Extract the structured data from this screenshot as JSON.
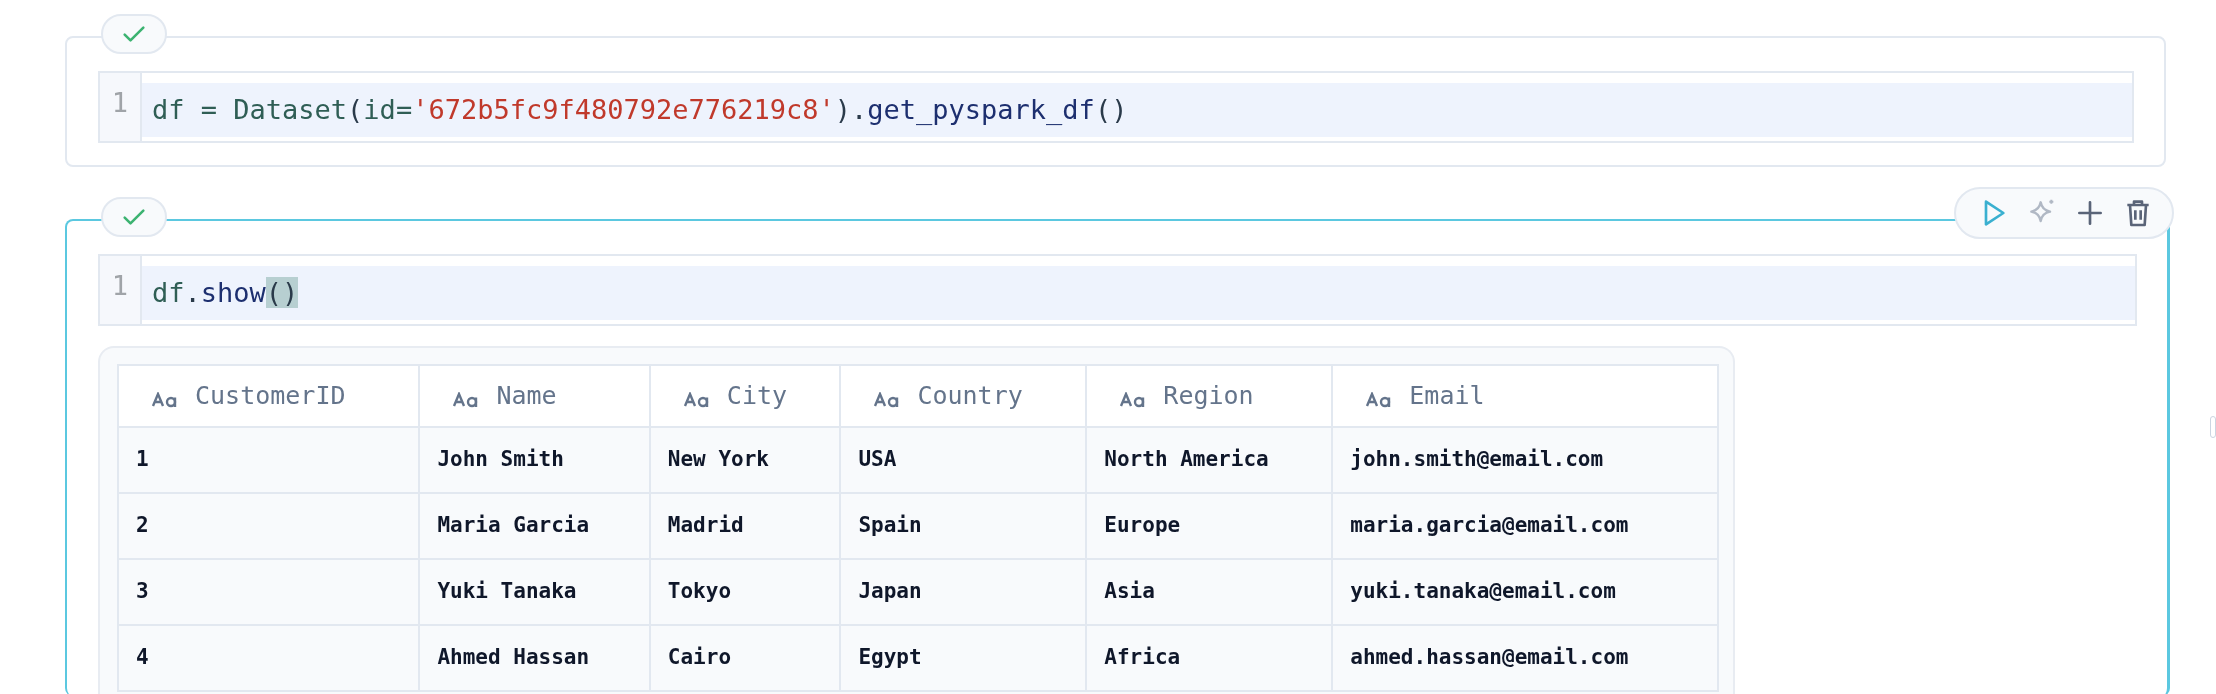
{
  "cells": [
    {
      "succeeded": true,
      "selected": false,
      "lines": [
        {
          "number": "1",
          "tokens": [
            {
              "kind": "name",
              "text": "df"
            },
            {
              "kind": "op",
              "text": " = "
            },
            {
              "kind": "name",
              "text": "Dataset"
            },
            {
              "kind": "punct",
              "text": "("
            },
            {
              "kind": "name",
              "text": "id"
            },
            {
              "kind": "op",
              "text": "="
            },
            {
              "kind": "string",
              "text": "'672b5fc9f480792e776219c8'"
            },
            {
              "kind": "punct",
              "text": ")."
            },
            {
              "kind": "func",
              "text": "get_pyspark_df"
            },
            {
              "kind": "punct",
              "text": "()"
            }
          ]
        }
      ]
    },
    {
      "succeeded": true,
      "selected": true,
      "lines": [
        {
          "number": "1",
          "tokens": [
            {
              "kind": "name",
              "text": "df"
            },
            {
              "kind": "punct",
              "text": "."
            },
            {
              "kind": "func",
              "text": "show"
            },
            {
              "kind": "match",
              "text": "()"
            }
          ]
        }
      ],
      "output": {
        "columns": [
          "CustomerID",
          "Name",
          "City",
          "Country",
          "Region",
          "Email"
        ],
        "rows": [
          [
            "1",
            "John Smith",
            "New York",
            "USA",
            "North America",
            "john.smith@email.com"
          ],
          [
            "2",
            "Maria Garcia",
            "Madrid",
            "Spain",
            "Europe",
            "maria.garcia@email.com"
          ],
          [
            "3",
            "Yuki Tanaka",
            "Tokyo",
            "Japan",
            "Asia",
            "yuki.tanaka@email.com"
          ],
          [
            "4",
            "Ahmed Hassan",
            "Cairo",
            "Egypt",
            "Africa",
            "ahmed.hassan@email.com"
          ]
        ]
      }
    }
  ]
}
